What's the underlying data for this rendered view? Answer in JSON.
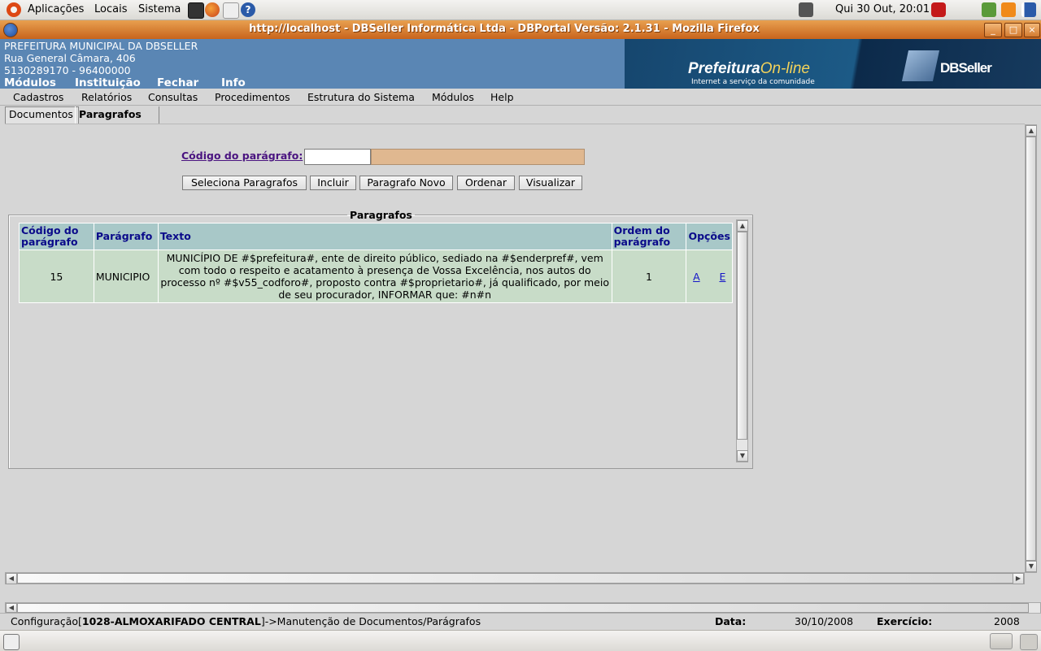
{
  "gnome_panel": {
    "menus": [
      "Aplicações",
      "Locais",
      "Sistema"
    ],
    "clock": "Qui 30 Out, 20:01"
  },
  "window": {
    "title": "http://localhost - DBSeller Informática Ltda - DBPortal Versão: 2.1.31 - Mozilla Firefox",
    "minimize": "_",
    "maximize": "□",
    "close": "×"
  },
  "header": {
    "org_name": "PREFEITURA MUNICIPAL DA DBSELLER",
    "address": "Rua General Câmara, 406",
    "phones": "5130289170  -  96400000",
    "menu": [
      "Módulos",
      "Instituição",
      "Fechar",
      "Info"
    ],
    "banner_title": "Prefeitura",
    "banner_title_accent": "On-line",
    "banner_tagline": "Internet a serviço da comunidade",
    "banner_brand": "DBSeller"
  },
  "menubar": [
    "Cadastros",
    "Relatórios",
    "Consultas",
    "Procedimentos",
    "Estrutura do Sistema",
    "Módulos",
    "Help"
  ],
  "tabs": [
    "Documentos",
    "Paragrafos"
  ],
  "form": {
    "codigo_label": "Código do parágrafo:",
    "codigo_value": "",
    "descricao_value": "",
    "buttons": [
      "Seleciona Paragrafos",
      "Incluir",
      "Paragrafo Novo",
      "Ordenar",
      "Visualizar"
    ]
  },
  "paragrafos": {
    "legend": "Paragrafos",
    "columns": [
      "Código do parágrafo",
      "Parágrafo",
      "Texto",
      "Ordem do parágrafo",
      "Opções"
    ],
    "rows": [
      {
        "codigo": "15",
        "paragrafo": "MUNICIPIO",
        "texto": "MUNICÍPIO DE #$prefeitura#, ente de direito público, sediado na #$enderpref#, vem com todo o respeito e acatamento à presença de Vossa Excelência, nos autos do processo nº #$v55_codforo#, proposto contra #$proprietario#, já qualificado, por meio de seu procurador, INFORMAR que: #n#n",
        "ordem": "1",
        "opt_a": "A",
        "opt_e": "E"
      }
    ]
  },
  "statusbar": {
    "config_prefix": "Configuração[",
    "config_bold": "1028-ALMOXARIFADO CENTRAL",
    "config_suffix": "]->Manutenção de Documentos/Parágrafos",
    "data_label": "Data:",
    "data_value": "30/10/2008",
    "exercicio_label": "Exercício:",
    "exercicio_value": "2008"
  },
  "colors": {
    "header_blue": "#5a86b4",
    "titlebar_orange": "#c8641c",
    "table_header": "#a8c8c8",
    "table_cell": "#c8dcc8",
    "link_purple": "#4a1480"
  }
}
